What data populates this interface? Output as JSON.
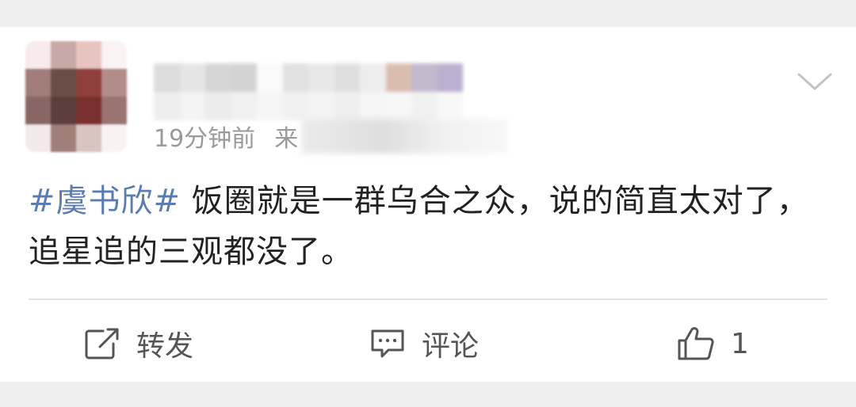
{
  "post": {
    "time": "19分钟前",
    "source_prefix": "来",
    "content_topic": "#虞书欣#",
    "content_text": " 饭圈就是一群乌合之众，说的简直太对了，追星追的三观都没了。"
  },
  "actions": {
    "repost_label": "转发",
    "comment_label": "评论",
    "like_count": "1"
  },
  "icons": {
    "repost": "share-icon",
    "comment": "comment-icon",
    "like": "thumbs-up-icon",
    "menu": "chevron-down-icon"
  },
  "colors": {
    "topic": "#5b7cb0",
    "text": "#222222",
    "meta": "#9a9a9a",
    "action": "#555555",
    "background": "#efefef"
  }
}
